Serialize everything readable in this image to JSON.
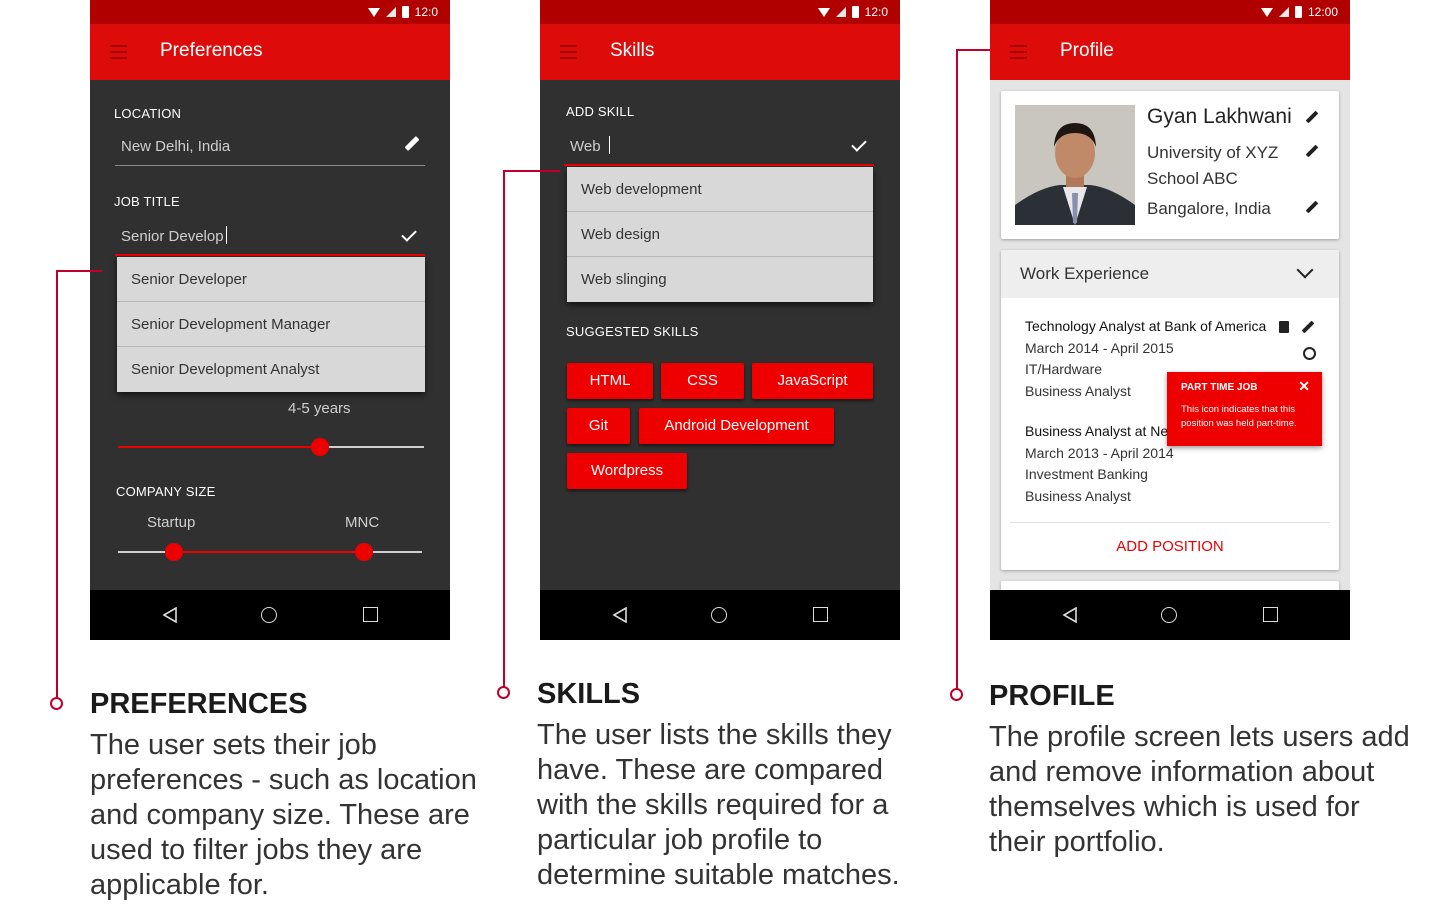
{
  "status_time_1": "12:0",
  "status_time_2": "12:0",
  "status_time_3": "12:00",
  "preferences": {
    "title": "Preferences",
    "location_label": "LOCATION",
    "location_value": "New Delhi, India",
    "job_title_label": "JOB TITLE",
    "job_title_value": "Senior Develop",
    "suggestions": [
      "Senior Developer",
      "Senior Development Manager",
      "Senior Development Analyst"
    ],
    "experience_value": "4-5 years",
    "experience_fraction": 0.66,
    "company_size_label": "COMPANY SIZE",
    "size_min_label": "Startup",
    "size_max_label": "MNC"
  },
  "skills": {
    "title": "Skills",
    "add_label": "ADD SKILL",
    "input_value": "Web",
    "suggestions": [
      "Web development",
      "Web design",
      "Web slinging"
    ],
    "suggested_label": "SUGGESTED SKILLS",
    "chips": [
      "HTML",
      "CSS",
      "JavaScript",
      "Git",
      "Android Development",
      "Wordpress"
    ]
  },
  "profile": {
    "title": "Profile",
    "name": "Gyan Lakhwani",
    "university": "University of XYZ",
    "school": "School ABC",
    "city": "Bangalore, India",
    "work_header": "Work Experience",
    "positions": [
      {
        "title": "Technology Analyst at Bank of America",
        "dates": "March 2014 - April 2015",
        "field": "IT/Hardware",
        "role": "Business Analyst"
      },
      {
        "title": "Business Analyst at Ne",
        "dates": "March 2013 - April 2014",
        "field": "Investment Banking",
        "role": "Business Analyst"
      }
    ],
    "add_position": "ADD POSITION",
    "tooltip_title": "PART TIME JOB",
    "tooltip_body": "This icon indicates that this position was held part-time.",
    "tooltip_close": "✕"
  },
  "captions": [
    {
      "title": "PREFERENCES",
      "body": "The user sets their job preferences - such as location and company size. These are used to filter jobs they are applicable for."
    },
    {
      "title": "SKILLS",
      "body": "The user lists the skills they have. These are compared with the skills required for a particular job profile to determine suitable matches."
    },
    {
      "title": "PROFILE",
      "body": "The profile screen lets users add and remove information about themselves which is used for their portfolio."
    }
  ],
  "colors": {
    "accent": "#de0b0b",
    "status": "#b00000",
    "screen_bg": "#303030"
  }
}
